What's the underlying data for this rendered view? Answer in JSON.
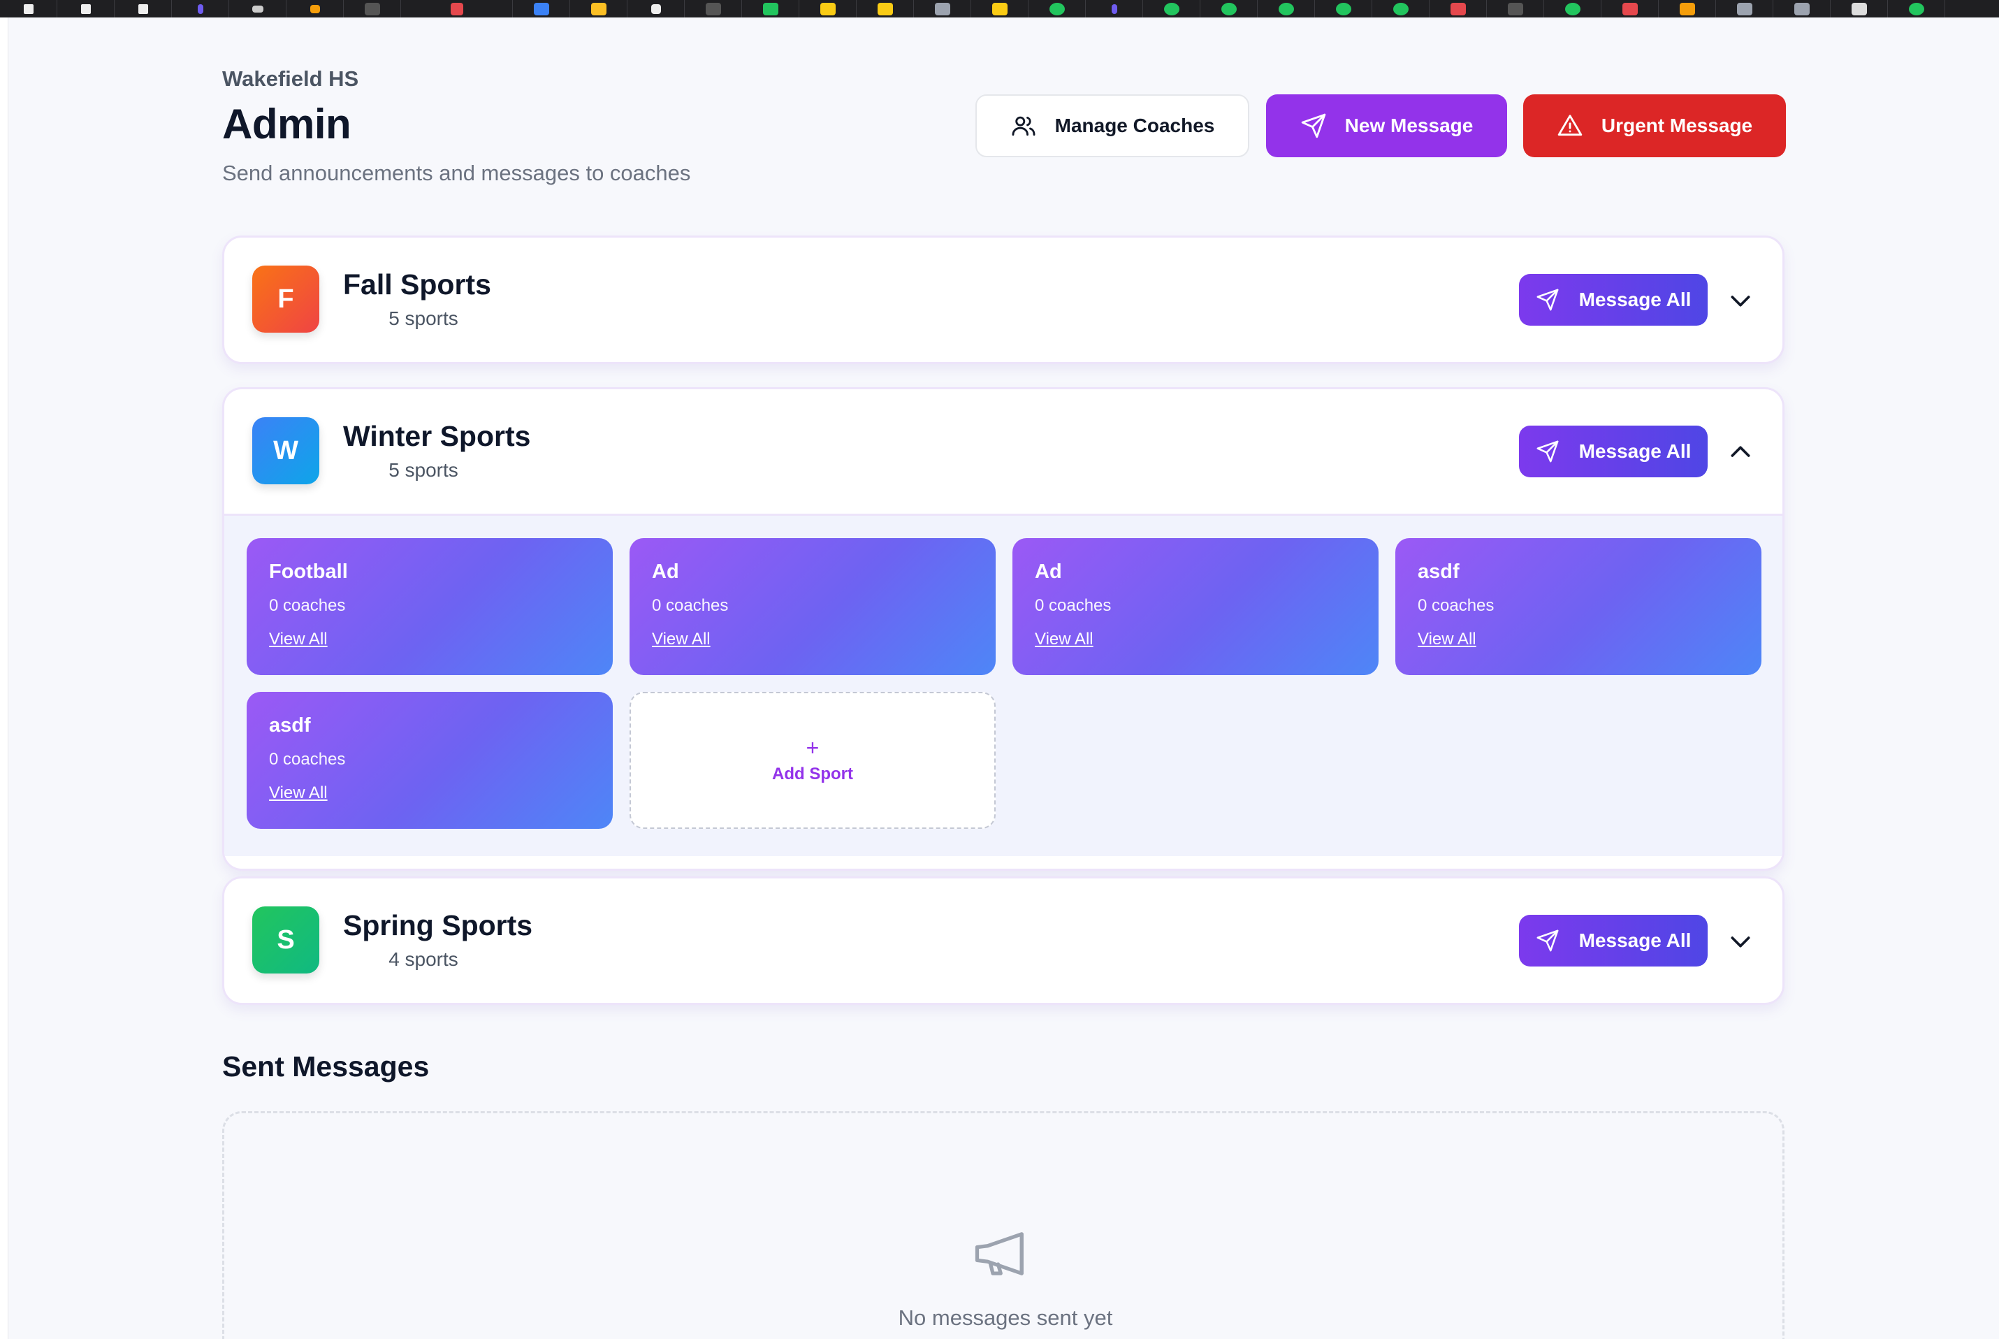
{
  "header": {
    "school": "Wakefield HS",
    "title": "Admin",
    "subtitle": "Send announcements and messages to coaches",
    "manage_coaches_label": "Manage Coaches",
    "new_message_label": "New Message",
    "urgent_message_label": "Urgent Message"
  },
  "seasons": [
    {
      "initial": "F",
      "name": "Fall Sports",
      "count": "5 sports",
      "message_all": "Message All",
      "badge_color": "#f25a2c",
      "expanded": false
    },
    {
      "initial": "W",
      "name": "Winter Sports",
      "count": "5 sports",
      "message_all": "Message All",
      "badge_color": "#2a96e8",
      "expanded": true
    },
    {
      "initial": "S",
      "name": "Spring Sports",
      "count": "4 sports",
      "message_all": "Message All",
      "badge_color": "#1fbf62",
      "expanded": false
    }
  ],
  "winter_sports": [
    {
      "name": "Football",
      "coaches": "0 coaches",
      "link": "View All"
    },
    {
      "name": "Ad",
      "coaches": "0 coaches",
      "link": "View All"
    },
    {
      "name": "Ad",
      "coaches": "0 coaches",
      "link": "View All"
    },
    {
      "name": "asdf",
      "coaches": "0 coaches",
      "link": "View All"
    },
    {
      "name": "asdf",
      "coaches": "0 coaches",
      "link": "View All"
    }
  ],
  "add_sport": {
    "plus": "+",
    "label": "Add Sport"
  },
  "sent_messages": {
    "title": "Sent Messages",
    "empty_text": "No messages sent yet",
    "icon": "megaphone-icon"
  },
  "colors": {
    "primary": "#9333ea",
    "urgent": "#dc2626",
    "accent_gradient_start": "#7c3aed",
    "accent_gradient_end": "#4f46e5"
  }
}
